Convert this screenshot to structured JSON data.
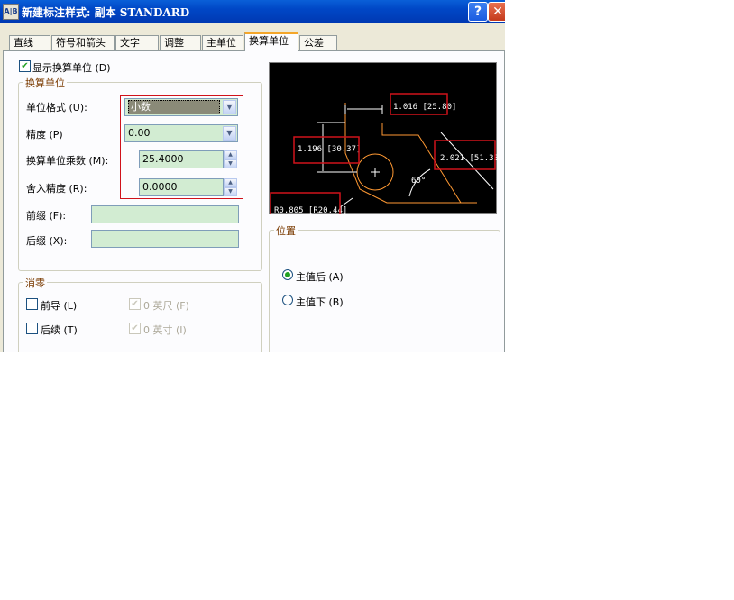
{
  "window": {
    "title": "新建标注样式: 副本 STANDARD",
    "icon_text": "A|B",
    "help_label": "?",
    "close_label": "✕"
  },
  "tabs": [
    {
      "label": "直线"
    },
    {
      "label": "符号和箭头"
    },
    {
      "label": "文字"
    },
    {
      "label": "调整"
    },
    {
      "label": "主单位"
    },
    {
      "label": "换算单位",
      "active": true
    },
    {
      "label": "公差"
    }
  ],
  "show_alt_units": {
    "label": "显示换算单位 (D)",
    "checked": true
  },
  "alt_units": {
    "title": "换算单位",
    "unit_format": {
      "label": "单位格式 (U):",
      "value": "小数"
    },
    "precision": {
      "label": "精度 (P)",
      "value": "0.00"
    },
    "multiplier": {
      "label": "换算单位乘数 (M):",
      "value": "25.4000"
    },
    "round_off": {
      "label": "舍入精度 (R):",
      "value": "0.0000"
    },
    "prefix": {
      "label": "前缀 (F):",
      "value": ""
    },
    "suffix": {
      "label": "后缀 (X):",
      "value": ""
    }
  },
  "zero_suppression": {
    "title": "消零",
    "leading": {
      "label": "前导 (L)",
      "checked": false
    },
    "trailing": {
      "label": "后续 (T)",
      "checked": false
    },
    "feet": {
      "label": "0 英尺 (F)",
      "checked": true,
      "disabled": true
    },
    "inches": {
      "label": "0 英寸 (I)",
      "checked": true,
      "disabled": true
    }
  },
  "preview": {
    "dim_top": "1.016 [25.80]",
    "dim_left": "1.196 [30.37]",
    "dim_right": "2.021 [51.33]",
    "angle": "60°",
    "radius": "R0.805 [R20.44]"
  },
  "placement": {
    "title": "位置",
    "after_primary": {
      "label": "主值后 (A)",
      "selected": true
    },
    "below_primary": {
      "label": "主值下 (B)",
      "selected": false
    }
  },
  "colors": {
    "titlebar": "#0047c6",
    "field_fill": "#d2ecd2",
    "highlight_border": "#d0121b",
    "group_title": "#7a3a00"
  }
}
